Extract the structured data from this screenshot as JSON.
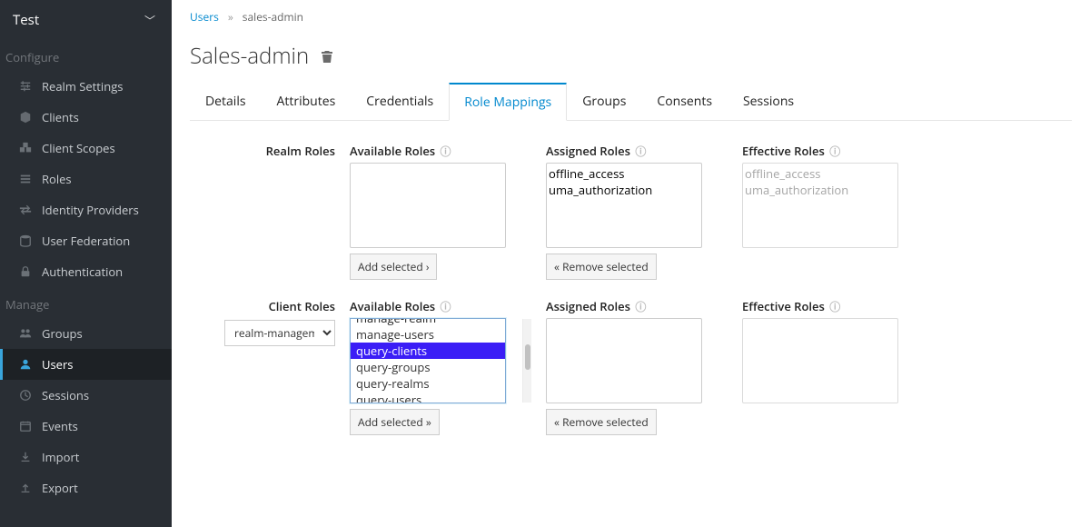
{
  "sidebar": {
    "realm_name": "Test",
    "sections": {
      "configure": "Configure",
      "manage": "Manage"
    },
    "configure_items": [
      {
        "id": "realm-settings",
        "label": "Realm Settings",
        "icon": "sliders"
      },
      {
        "id": "clients",
        "label": "Clients",
        "icon": "cube"
      },
      {
        "id": "client-scopes",
        "label": "Client Scopes",
        "icon": "cubes"
      },
      {
        "id": "roles",
        "label": "Roles",
        "icon": "list"
      },
      {
        "id": "identity-providers",
        "label": "Identity Providers",
        "icon": "exchange"
      },
      {
        "id": "user-federation",
        "label": "User Federation",
        "icon": "database"
      },
      {
        "id": "authentication",
        "label": "Authentication",
        "icon": "lock"
      }
    ],
    "manage_items": [
      {
        "id": "groups",
        "label": "Groups",
        "icon": "users"
      },
      {
        "id": "users",
        "label": "Users",
        "icon": "user",
        "active": true
      },
      {
        "id": "sessions",
        "label": "Sessions",
        "icon": "clock"
      },
      {
        "id": "events",
        "label": "Events",
        "icon": "calendar"
      },
      {
        "id": "import",
        "label": "Import",
        "icon": "download"
      },
      {
        "id": "export",
        "label": "Export",
        "icon": "upload"
      }
    ]
  },
  "breadcrumb": {
    "root": "Users",
    "current": "sales-admin"
  },
  "title": "Sales-admin",
  "tabs": [
    {
      "id": "details",
      "label": "Details"
    },
    {
      "id": "attributes",
      "label": "Attributes"
    },
    {
      "id": "credentials",
      "label": "Credentials"
    },
    {
      "id": "role-mappings",
      "label": "Role Mappings",
      "active": true
    },
    {
      "id": "groups",
      "label": "Groups"
    },
    {
      "id": "consents",
      "label": "Consents"
    },
    {
      "id": "sessions",
      "label": "Sessions"
    }
  ],
  "realm_roles": {
    "row_label": "Realm Roles",
    "available_label": "Available Roles",
    "assigned_label": "Assigned Roles",
    "effective_label": "Effective Roles",
    "available": [],
    "assigned": [
      "offline_access",
      "uma_authorization"
    ],
    "effective": [
      "offline_access",
      "uma_authorization"
    ],
    "add_btn": "Add selected ›",
    "remove_btn": "« Remove selected"
  },
  "client_roles": {
    "row_label": "Client Roles",
    "dropdown_selected": "realm-management",
    "available_label": "Available Roles",
    "assigned_label": "Assigned Roles",
    "effective_label": "Effective Roles",
    "available_visible": [
      "manage-realm",
      "manage-users",
      "query-clients",
      "query-groups",
      "query-realms",
      "query-users"
    ],
    "cut_top": "manage-realm",
    "selected_option": "query-clients",
    "assigned": [],
    "effective": [],
    "add_btn": "Add selected »",
    "remove_btn": "« Remove selected"
  }
}
